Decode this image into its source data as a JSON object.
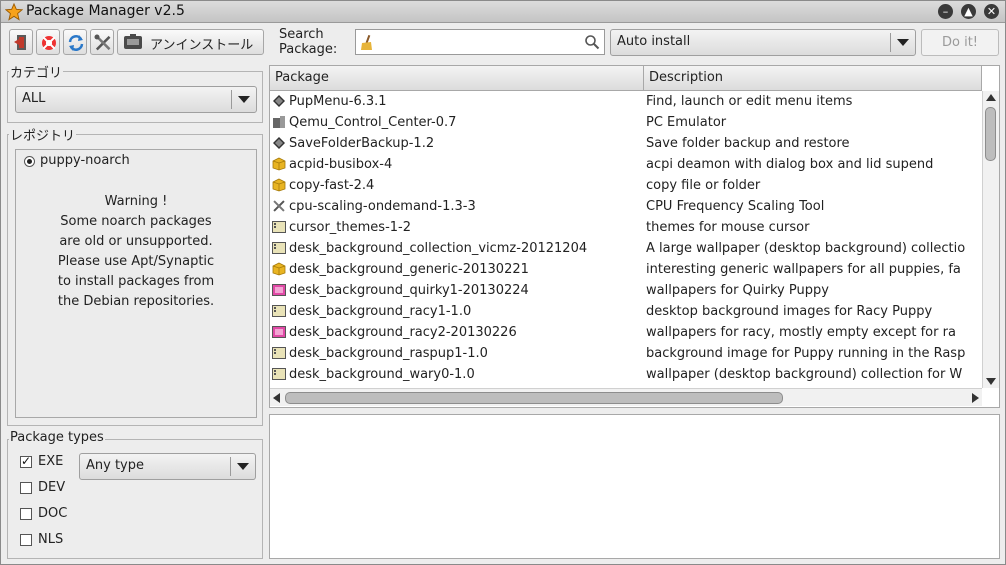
{
  "window": {
    "title": "Package Manager v2.5"
  },
  "toolbar": {
    "uninstall_label": "アンインストール",
    "search_label_line1": "Search",
    "search_label_line2": "Package:",
    "search_value": "",
    "install_mode": "Auto install",
    "doit_label": "Do it!"
  },
  "category": {
    "label": "カテゴリ",
    "value": "ALL"
  },
  "repository": {
    "label": "レポジトリ",
    "name": "puppy-noarch",
    "warning": [
      "Warning !",
      "Some noarch packages",
      "are old or unsupported.",
      "Please use Apt/Synaptic",
      "to install packages from",
      "the Debian repositories."
    ]
  },
  "package_types": {
    "label": "Package types",
    "items": [
      {
        "label": "EXE",
        "checked": true
      },
      {
        "label": "DEV",
        "checked": false
      },
      {
        "label": "DOC",
        "checked": false
      },
      {
        "label": "NLS",
        "checked": false
      }
    ],
    "type_select": "Any type"
  },
  "table": {
    "col_package": "Package",
    "col_description": "Description",
    "rows": [
      {
        "name": "PupMenu-6.3.1",
        "desc": "Find, launch or edit menu items",
        "icon": "diamond"
      },
      {
        "name": "Qemu_Control_Center-0.7",
        "desc": "PC Emulator",
        "icon": "computer"
      },
      {
        "name": "SaveFolderBackup-1.2",
        "desc": "Save folder backup and restore",
        "icon": "diamond"
      },
      {
        "name": "acpid-busibox-4",
        "desc": "acpi deamon with dialog box and lid supend",
        "icon": "package"
      },
      {
        "name": "copy-fast-2.4",
        "desc": "copy file or folder",
        "icon": "package"
      },
      {
        "name": "cpu-scaling-ondemand-1.3-3",
        "desc": "CPU Frequency Scaling Tool",
        "icon": "tools"
      },
      {
        "name": "cursor_themes-1-2",
        "desc": "themes for mouse cursor",
        "icon": "desktop"
      },
      {
        "name": "desk_background_collection_vicmz-20121204",
        "desc": "A large wallpaper (desktop background) collectio",
        "icon": "desktop"
      },
      {
        "name": "desk_background_generic-20130221",
        "desc": "interesting generic wallpapers for all puppies, fa",
        "icon": "package"
      },
      {
        "name": "desk_background_quirky1-20130224",
        "desc": "wallpapers for Quirky Puppy",
        "icon": "image"
      },
      {
        "name": "desk_background_racy1-1.0",
        "desc": "desktop background images for Racy Puppy",
        "icon": "desktop"
      },
      {
        "name": "desk_background_racy2-20130226",
        "desc": "wallpapers for racy, mostly empty except for ra",
        "icon": "image"
      },
      {
        "name": "desk_background_raspup1-1.0",
        "desc": "background image for Puppy running in the Rasp",
        "icon": "desktop"
      },
      {
        "name": "desk_background_wary0-1.0",
        "desc": "wallpaper (desktop background) collection for W",
        "icon": "desktop"
      }
    ]
  },
  "colors": {
    "window_bg": "#ededed",
    "list_bg": "#ffffff"
  }
}
